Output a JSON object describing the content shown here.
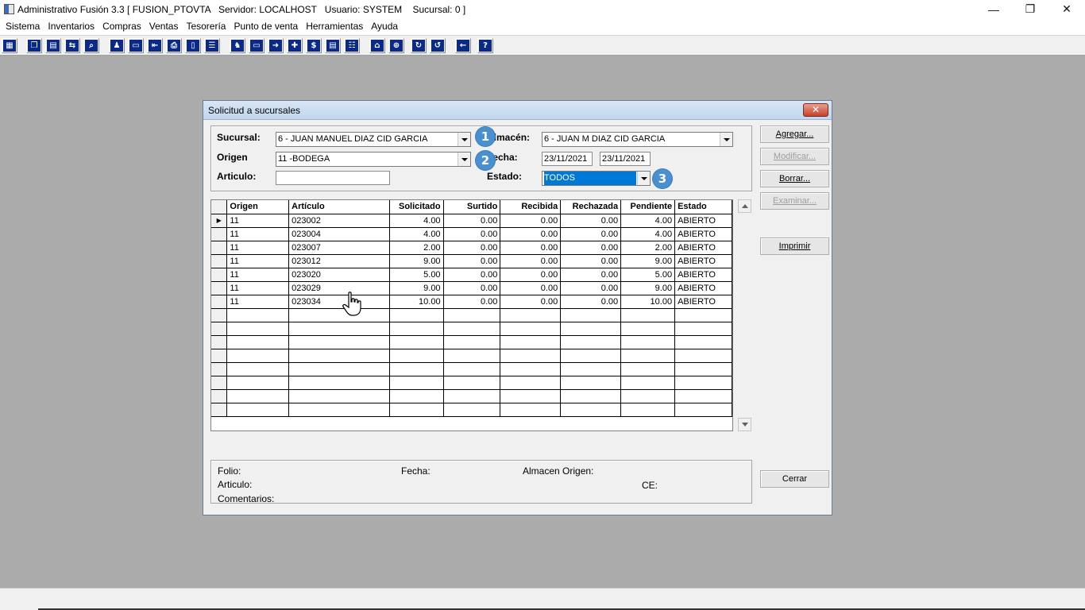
{
  "window": {
    "title": "Administrativo Fusión 3.3 [ FUSION_PTOVTA   Servidor: LOCALHOST   Usuario: SYSTEM    Sucursal: 0 ]",
    "minimize": "—",
    "restore": "❐",
    "close": "✕"
  },
  "menu": [
    "Sistema",
    "Inventarios",
    "Compras",
    "Ventas",
    "Tesorería",
    "Punto de venta",
    "Herramientas",
    "Ayuda"
  ],
  "toolbar_icons": [
    "calculator-icon",
    "copy-icon",
    "clipboard-icon",
    "transfer-icon",
    "search-doc-icon",
    "user-icon",
    "folder-icon",
    "exit-icon",
    "print-icon",
    "document-icon",
    "list-icon",
    "users-icon",
    "card-icon",
    "export-icon",
    "add-icon",
    "dollar-icon",
    "report-icon",
    "table-icon",
    "home-icon",
    "zoom-icon",
    "refresh-icon",
    "undo-icon",
    "back-icon",
    "help-icon"
  ],
  "dialog": {
    "title": "Solicitud a sucursales",
    "close": "✕",
    "filters": {
      "sucursal_label": "Sucursal:",
      "sucursal_value": "6 - JUAN MANUEL DIAZ CID GARCIA",
      "origen_label": "Origen",
      "origen_value": "11  -BODEGA",
      "articulo_label": "Articulo:",
      "articulo_value": "",
      "almacen_label": "Almacén:",
      "almacen_value": "6 - JUAN M DIAZ CID GARCIA",
      "fecha_label": "Fecha:",
      "fecha_from": "23/11/2021",
      "fecha_to": "23/11/2021",
      "estado_label": "Estado:",
      "estado_value": "TODOS"
    },
    "badges": [
      "1",
      "2",
      "3"
    ],
    "buttons": {
      "agregar": "Agregar...",
      "modificar": "Modificar...",
      "borrar": "Borrar...",
      "examinar": "Examinar...",
      "imprimir": "Imprimir",
      "cerrar": "Cerrar"
    },
    "grid": {
      "columns": [
        "Origen",
        "Artículo",
        "Solicitado",
        "Surtido",
        "Recibida",
        "Rechazada",
        "Pendiente",
        "Estado"
      ],
      "rows": [
        [
          "11",
          "023002",
          "4.00",
          "0.00",
          "0.00",
          "0.00",
          "4.00",
          "ABIERTO"
        ],
        [
          "11",
          "023004",
          "4.00",
          "0.00",
          "0.00",
          "0.00",
          "4.00",
          "ABIERTO"
        ],
        [
          "11",
          "023007",
          "2.00",
          "0.00",
          "0.00",
          "0.00",
          "2.00",
          "ABIERTO"
        ],
        [
          "11",
          "023012",
          "9.00",
          "0.00",
          "0.00",
          "0.00",
          "9.00",
          "ABIERTO"
        ],
        [
          "11",
          "023020",
          "5.00",
          "0.00",
          "0.00",
          "0.00",
          "5.00",
          "ABIERTO"
        ],
        [
          "11",
          "023029",
          "9.00",
          "0.00",
          "0.00",
          "0.00",
          "9.00",
          "ABIERTO"
        ],
        [
          "11",
          "023034",
          "10.00",
          "0.00",
          "0.00",
          "0.00",
          "10.00",
          "ABIERTO"
        ]
      ],
      "current_row_marker": "▶"
    },
    "details": {
      "folio": "Folio:",
      "fecha": "Fecha:",
      "almacen_origen": "Almacen Origen:",
      "articulo": "Articulo:",
      "ce": "CE:",
      "comentarios": "Comentarios:"
    }
  }
}
